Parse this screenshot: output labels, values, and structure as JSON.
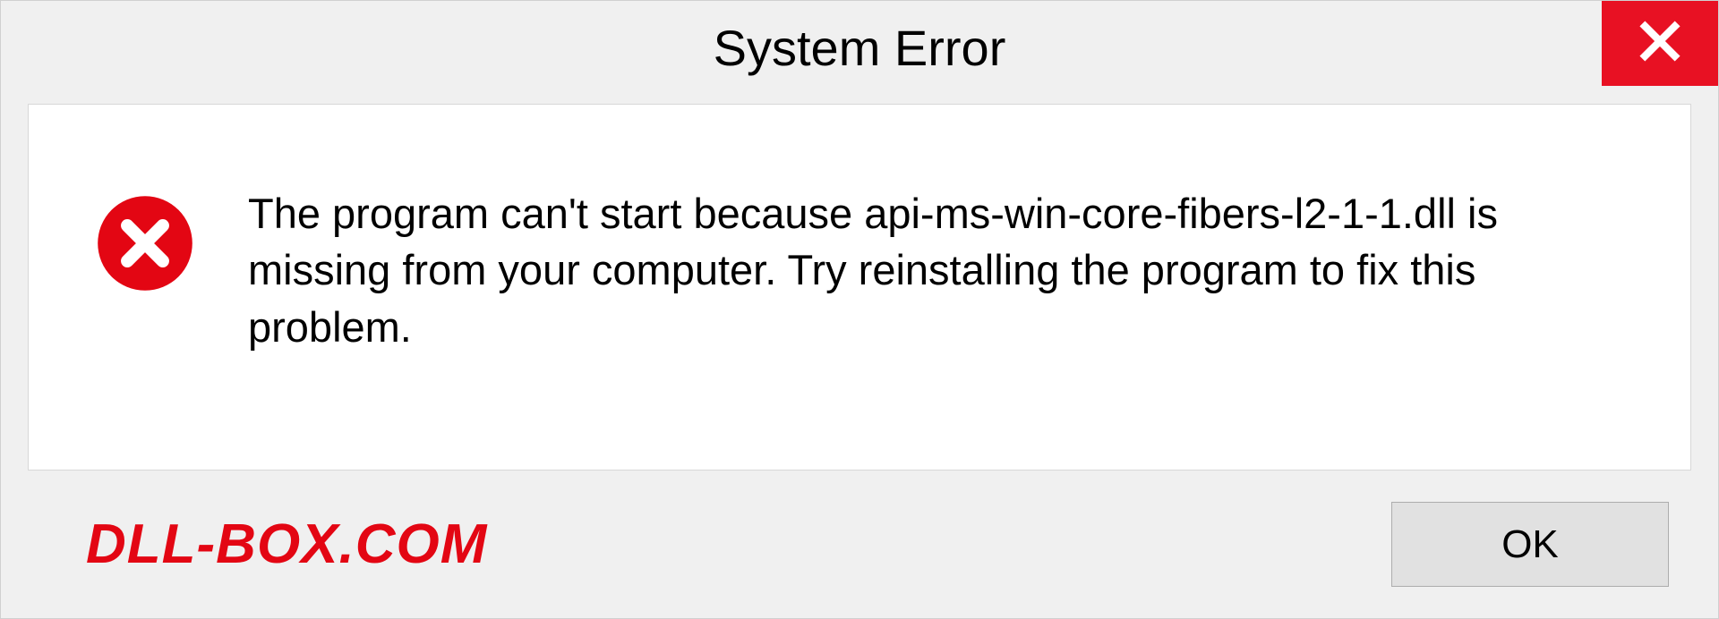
{
  "dialog": {
    "title": "System Error",
    "message": "The program can't start because api-ms-win-core-fibers-l2-1-1.dll is missing from your computer. Try reinstalling the program to fix this problem.",
    "ok_label": "OK"
  },
  "watermark": "DLL-BOX.COM",
  "colors": {
    "close_bg": "#e81123",
    "error_icon": "#e30613",
    "watermark": "#e30613"
  }
}
